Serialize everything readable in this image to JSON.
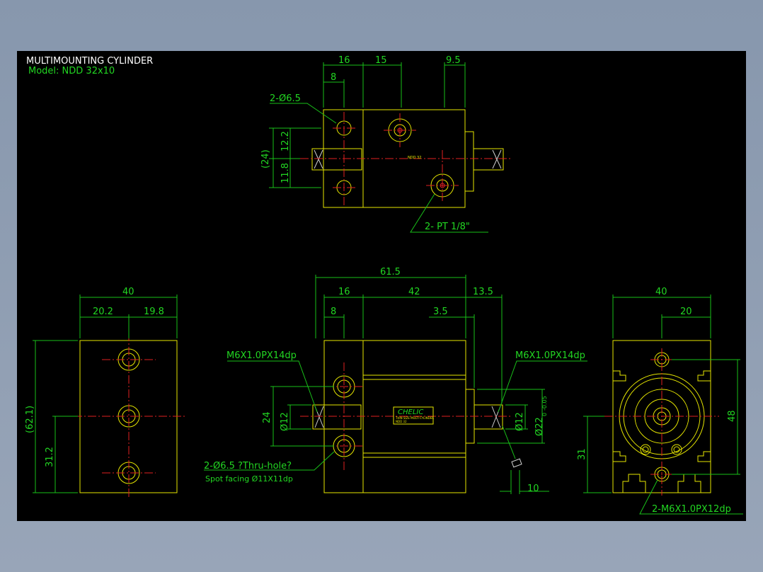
{
  "title": {
    "name": "MULTIMOUNTING CYLINDER",
    "model": "Model:  NDD  32x10"
  },
  "colors": {
    "background": "#000000",
    "outline": "#e6e600",
    "dimension": "#19c119",
    "centerline": "#e02020",
    "title": "#ffffff"
  },
  "top_view": {
    "dims": {
      "d16": "16",
      "d15": "15",
      "d9_5": "9.5",
      "d8": "8",
      "d12_2": "12.2",
      "d11_8": "11.8",
      "d24": "(24)"
    },
    "hole_label": "2-Ø6.5",
    "port_label": "2-  PT  1/8\"",
    "marking": "NDD 32"
  },
  "side_view": {
    "dims": {
      "d40": "40",
      "d20_2": "20.2",
      "d19_8": "19.8",
      "d62_1": "(62.1)",
      "d31_2": "31.2"
    }
  },
  "front_view": {
    "dims": {
      "d61_5": "61.5",
      "d16": "16",
      "d42": "42",
      "d13_5": "13.5",
      "d8": "8",
      "d3_5": "3.5",
      "d24": "24",
      "d12a": "Ø12",
      "d12b": "Ø12",
      "d22": "Ø22",
      "tol": "-0.05",
      "tol0": "0",
      "d10": "10"
    },
    "thread_left": "M6X1.0PX14dp",
    "thread_right": "M6X1.0PX14dp",
    "hole_note": "2-Ø6.5 ?Thru-hole?",
    "spot_facing": "Spot facing   Ø11X11dp",
    "brand": "CHELIC",
    "nameplate_line1": "THIN SIZE MULTI CYLINDER",
    "nameplate_line2": "NDD 32"
  },
  "end_view": {
    "dims": {
      "d40": "40",
      "d20": "20",
      "d48": "48",
      "d31": "31"
    },
    "thread_label": "2-M6X1.0PX12dp"
  }
}
